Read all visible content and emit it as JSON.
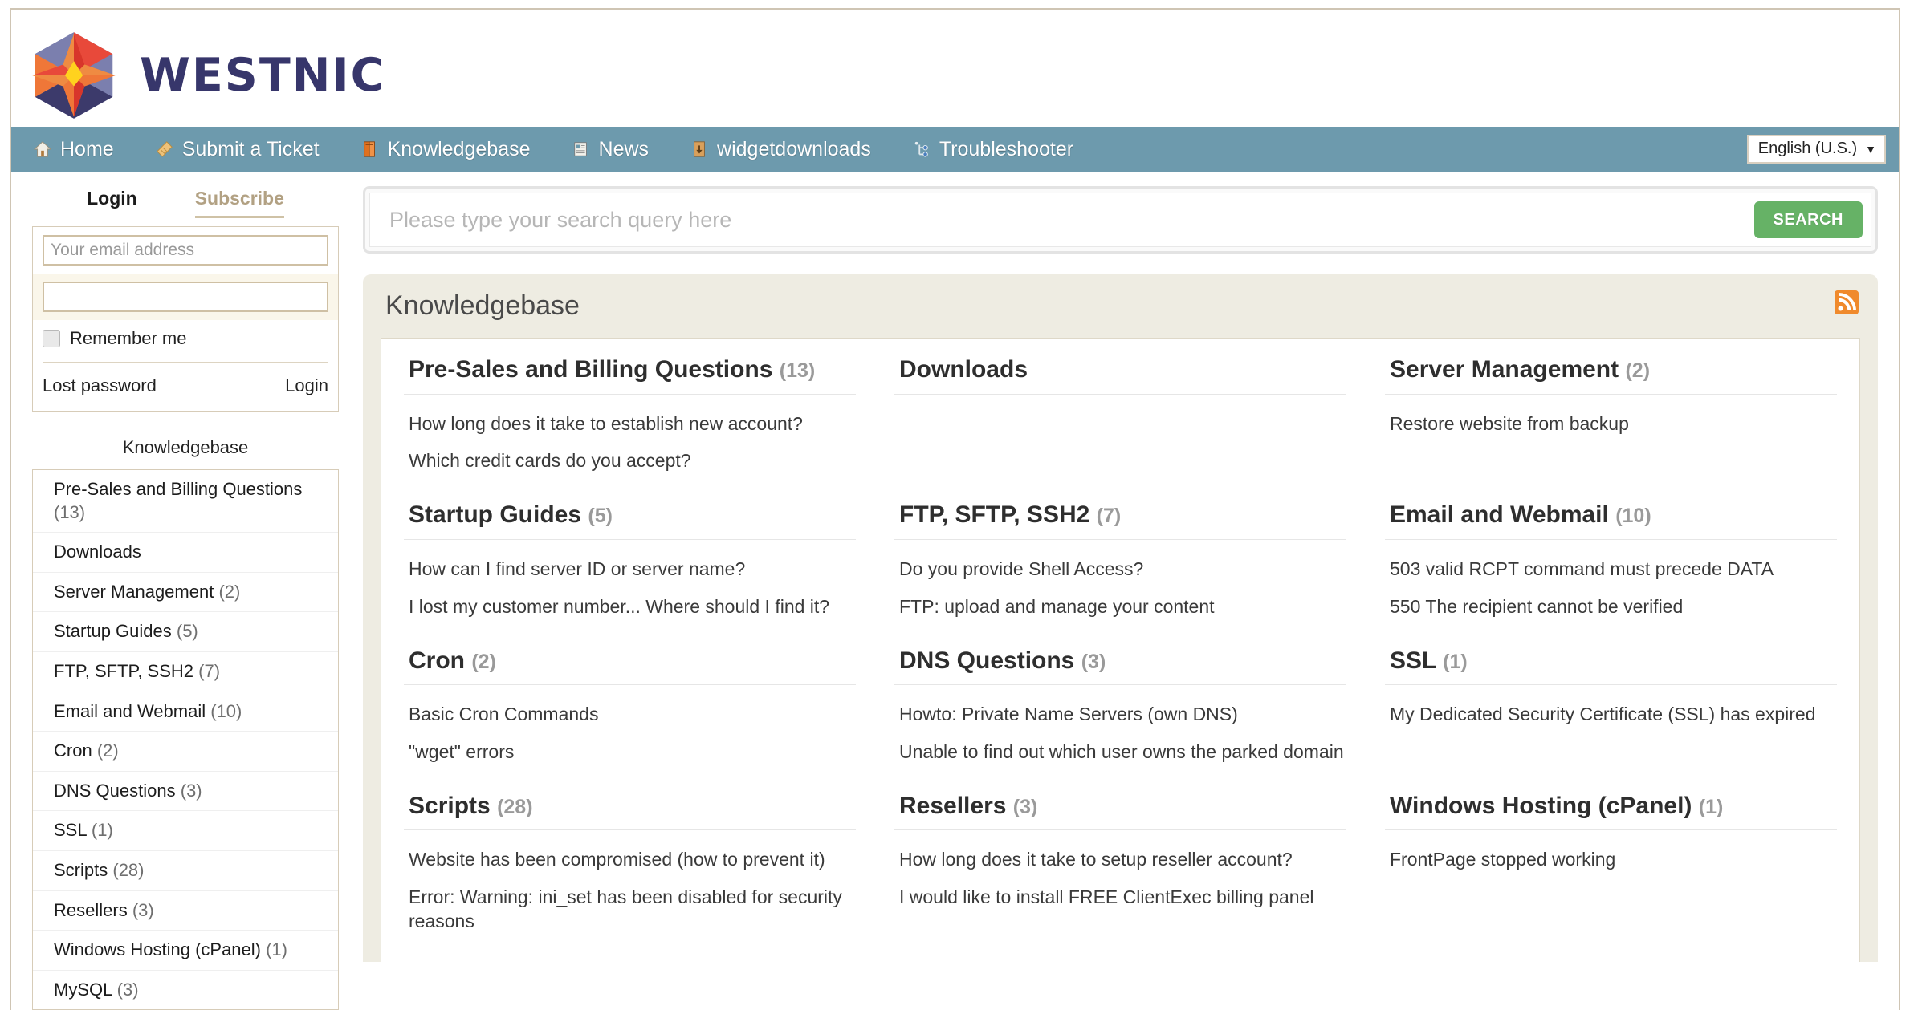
{
  "brand": {
    "name": "WESTNIC"
  },
  "nav": {
    "items": [
      {
        "label": "Home",
        "icon": "home-icon"
      },
      {
        "label": "Submit a Ticket",
        "icon": "ticket-icon"
      },
      {
        "label": "Knowledgebase",
        "icon": "book-icon"
      },
      {
        "label": "News",
        "icon": "news-icon"
      },
      {
        "label": "widgetdownloads",
        "icon": "download-icon"
      },
      {
        "label": "Troubleshooter",
        "icon": "troubleshooter-icon"
      }
    ],
    "language": {
      "label": "English (U.S.)",
      "caret": "▼"
    }
  },
  "login": {
    "tab_login": "Login",
    "tab_subscribe": "Subscribe",
    "email_placeholder": "Your email address",
    "email_value": "",
    "password_placeholder": "",
    "password_value": "",
    "remember_label": "Remember me",
    "lost_password": "Lost password",
    "login_button": "Login"
  },
  "sidebar": {
    "title": "Knowledgebase",
    "items": [
      {
        "label": "Pre-Sales and Billing Questions",
        "count": "(13)"
      },
      {
        "label": "Downloads",
        "count": ""
      },
      {
        "label": "Server Management",
        "count": "(2)"
      },
      {
        "label": "Startup Guides",
        "count": "(5)"
      },
      {
        "label": "FTP, SFTP, SSH2",
        "count": "(7)"
      },
      {
        "label": "Email and Webmail",
        "count": "(10)"
      },
      {
        "label": "Cron",
        "count": "(2)"
      },
      {
        "label": "DNS Questions",
        "count": "(3)"
      },
      {
        "label": "SSL",
        "count": "(1)"
      },
      {
        "label": "Scripts",
        "count": "(28)"
      },
      {
        "label": "Resellers",
        "count": "(3)"
      },
      {
        "label": "Windows Hosting (cPanel)",
        "count": "(1)"
      },
      {
        "label": "MySQL",
        "count": "(3)"
      }
    ]
  },
  "search": {
    "placeholder": "Please type your search query here",
    "value": "",
    "button_label": "SEARCH"
  },
  "panel": {
    "title": "Knowledgebase",
    "rss_icon": "rss-icon"
  },
  "categories": [
    {
      "name": "Pre-Sales and Billing Questions",
      "count": "(13)",
      "articles": [
        "How long does it take to establish new account?",
        "Which credit cards do you accept?"
      ]
    },
    {
      "name": "Downloads",
      "count": "",
      "articles": []
    },
    {
      "name": "Server Management",
      "count": "(2)",
      "articles": [
        "Restore website from backup"
      ]
    },
    {
      "name": "Startup Guides",
      "count": "(5)",
      "articles": [
        "How can I find server ID or server name?",
        "I lost my customer number... Where should I find it?"
      ]
    },
    {
      "name": "FTP, SFTP, SSH2",
      "count": "(7)",
      "articles": [
        "Do you provide Shell Access?",
        "FTP: upload and manage your content"
      ]
    },
    {
      "name": "Email and Webmail",
      "count": "(10)",
      "articles": [
        "503 valid RCPT command must precede DATA",
        "550 The recipient cannot be verified"
      ]
    },
    {
      "name": "Cron",
      "count": "(2)",
      "articles": [
        "Basic Cron Commands",
        "\"wget\" errors"
      ]
    },
    {
      "name": "DNS Questions",
      "count": "(3)",
      "articles": [
        "Howto: Private Name Servers (own DNS)",
        "Unable to find out which user owns the parked domain"
      ]
    },
    {
      "name": "SSL",
      "count": "(1)",
      "articles": [
        "My Dedicated Security Certificate (SSL) has expired"
      ]
    },
    {
      "name": "Scripts",
      "count": "(28)",
      "articles": [
        "Website has been compromised (how to prevent it)",
        "Error: Warning: ini_set has been disabled for security reasons"
      ]
    },
    {
      "name": "Resellers",
      "count": "(3)",
      "articles": [
        "How long does it take to setup reseller account?",
        "I would like to install FREE ClientExec billing panel"
      ]
    },
    {
      "name": "Windows Hosting (cPanel)",
      "count": "(1)",
      "articles": [
        "FrontPage stopped working"
      ]
    }
  ],
  "colors": {
    "nav_bg": "#6d9aad",
    "panel_bg": "#eeece2",
    "accent_green": "#66b266",
    "brand_navy": "#37366b",
    "rss_orange": "#f08a2c"
  }
}
